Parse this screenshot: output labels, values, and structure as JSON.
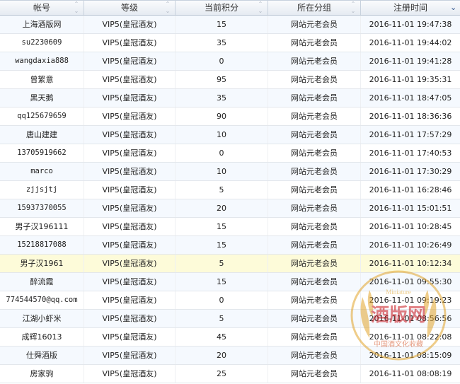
{
  "columns": [
    "帐号",
    "等级",
    "当前积分",
    "所在分组",
    "注册时间"
  ],
  "rows": [
    {
      "account": "上海酒版网",
      "level": "VIP5(皇冠酒友)",
      "points": "15",
      "group": "网站元老会员",
      "time": "2016-11-01 19:47:38"
    },
    {
      "account": "su2230609",
      "level": "VIP5(皇冠酒友)",
      "points": "35",
      "group": "网站元老会员",
      "time": "2016-11-01 19:44:02"
    },
    {
      "account": "wangdaxia888",
      "level": "VIP5(皇冠酒友)",
      "points": "0",
      "group": "网站元老会员",
      "time": "2016-11-01 19:41:28"
    },
    {
      "account": "曾繁意",
      "level": "VIP5(皇冠酒友)",
      "points": "95",
      "group": "网站元老会员",
      "time": "2016-11-01 19:35:31"
    },
    {
      "account": "黑天鹅",
      "level": "VIP5(皇冠酒友)",
      "points": "35",
      "group": "网站元老会员",
      "time": "2016-11-01 18:47:05"
    },
    {
      "account": "qq125679659",
      "level": "VIP5(皇冠酒友)",
      "points": "90",
      "group": "网站元老会员",
      "time": "2016-11-01 18:36:36"
    },
    {
      "account": "唐山建建",
      "level": "VIP5(皇冠酒友)",
      "points": "10",
      "group": "网站元老会员",
      "time": "2016-11-01 17:57:29"
    },
    {
      "account": "13705919662",
      "level": "VIP5(皇冠酒友)",
      "points": "0",
      "group": "网站元老会员",
      "time": "2016-11-01 17:40:53"
    },
    {
      "account": "marco",
      "level": "VIP5(皇冠酒友)",
      "points": "10",
      "group": "网站元老会员",
      "time": "2016-11-01 17:30:29"
    },
    {
      "account": "zjjsjtj",
      "level": "VIP5(皇冠酒友)",
      "points": "5",
      "group": "网站元老会员",
      "time": "2016-11-01 16:28:46"
    },
    {
      "account": "15937370055",
      "level": "VIP5(皇冠酒友)",
      "points": "20",
      "group": "网站元老会员",
      "time": "2016-11-01 15:01:51"
    },
    {
      "account": "男子汉196111",
      "level": "VIP5(皇冠酒友)",
      "points": "15",
      "group": "网站元老会员",
      "time": "2016-11-01 10:28:45"
    },
    {
      "account": "15218817088",
      "level": "VIP5(皇冠酒友)",
      "points": "15",
      "group": "网站元老会员",
      "time": "2016-11-01 10:26:49"
    },
    {
      "account": "男子汉1961",
      "level": "VIP5(皇冠酒友)",
      "points": "5",
      "group": "网站元老会员",
      "time": "2016-11-01 10:12:34",
      "selected": true
    },
    {
      "account": "醉流霞",
      "level": "VIP5(皇冠酒友)",
      "points": "15",
      "group": "网站元老会员",
      "time": "2016-11-01 09:55:30"
    },
    {
      "account": "774544570@qq.com",
      "level": "VIP5(皇冠酒友)",
      "points": "0",
      "group": "网站元老会员",
      "time": "2016-11-01 09:19:23"
    },
    {
      "account": "江湖小虾米",
      "level": "VIP5(皇冠酒友)",
      "points": "5",
      "group": "网站元老会员",
      "time": "2016-11-01 08:56:56"
    },
    {
      "account": "成辉16013",
      "level": "VIP5(皇冠酒友)",
      "points": "45",
      "group": "网站元老会员",
      "time": "2016-11-01 08:22:08"
    },
    {
      "account": "仕舜酒版",
      "level": "VIP5(皇冠酒友)",
      "points": "20",
      "group": "网站元老会员",
      "time": "2016-11-01 08:15:09"
    },
    {
      "account": "房家驹",
      "level": "VIP5(皇冠酒友)",
      "points": "25",
      "group": "网站元老会员",
      "time": "2016-11-01 08:08:19"
    }
  ],
  "sort": {
    "column_index": 4,
    "direction": "descending",
    "icon": "sort-desc-icon"
  },
  "colors": {
    "header_bg": "#e6ebf2",
    "row_alt": "#f5f9fe",
    "selected_row": "#fdfbd9",
    "watermark": "#e2a52c"
  },
  "watermark": {
    "main": "酒版网",
    "top": "Miniature",
    "bottom": "中国酒文化收藏",
    "icon": "seal-logo"
  }
}
